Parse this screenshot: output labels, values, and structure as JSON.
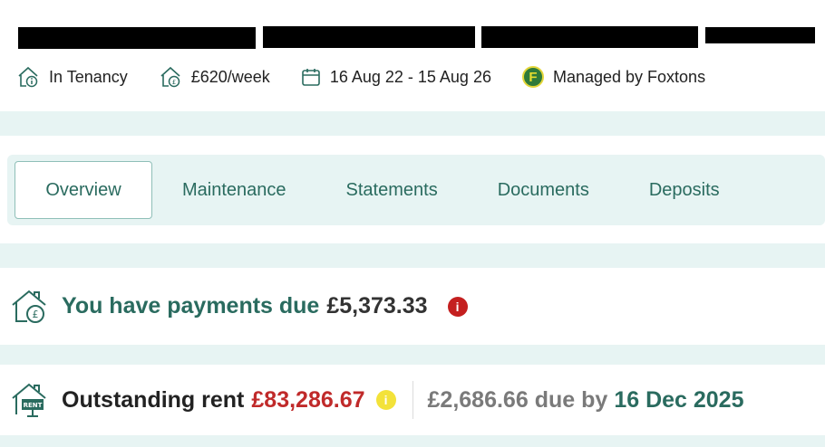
{
  "property": {
    "status": "In Tenancy",
    "rent": "£620/week",
    "tenancy_dates": "16 Aug 22 - 15 Aug 26",
    "agent_badge": "F",
    "agent": "Managed by Foxtons"
  },
  "tabs": [
    {
      "label": "Overview",
      "active": true
    },
    {
      "label": "Maintenance"
    },
    {
      "label": "Statements"
    },
    {
      "label": "Documents"
    },
    {
      "label": "Deposits"
    }
  ],
  "payments": {
    "title": "You have payments due",
    "amount": "£5,373.33",
    "alert_icon": "i"
  },
  "rent": {
    "label": "Outstanding rent",
    "amount": "£83,286.67",
    "info_icon": "i",
    "next_due_amount": "£2,686.66",
    "due_by_text": "due by",
    "due_date": "16 Dec 2025",
    "icon_text": "RENT"
  },
  "colors": {
    "brand_green": "#2a6b5f",
    "band_bg": "#e7f4f3",
    "alert_red": "#c41f1f",
    "warning_yellow": "#f3e23a",
    "rent_red": "#c02a2a"
  }
}
